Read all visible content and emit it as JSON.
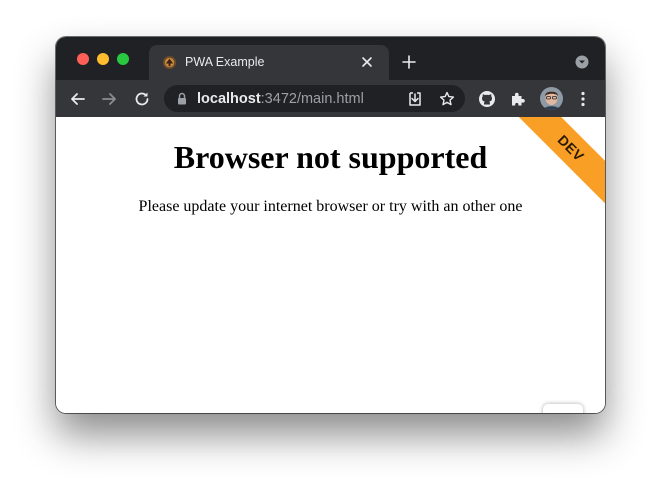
{
  "browser": {
    "tab": {
      "title": "PWA Example",
      "favicon": "pwa-logo-icon"
    },
    "address_bar": {
      "host": "localhost",
      "rest": ":3472/main.html"
    },
    "toolbar_icons": [
      "back-icon",
      "forward-icon",
      "reload-icon",
      "lock-icon",
      "install-icon",
      "bookmark-star-icon",
      "github-icon",
      "extensions-icon",
      "avatar",
      "menu-icon"
    ],
    "colors": {
      "tabstrip": "#202124",
      "toolbar": "#35363a",
      "omnibox": "#202124",
      "ribbon": "#f99f26"
    }
  },
  "page": {
    "heading": "Browser not supported",
    "message": "Please update your internet browser or try with an other one",
    "ribbon_label": "DEV"
  }
}
